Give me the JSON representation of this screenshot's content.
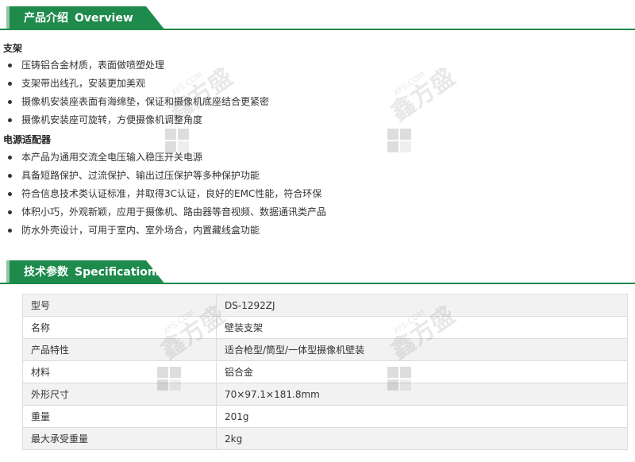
{
  "overview": {
    "title_cn": "产品介绍",
    "title_en": "Overview",
    "groups": [
      {
        "title": "支架",
        "items": [
          "压铸铝合金材质，表面做喷塑处理",
          "支架带出线孔，安装更加美观",
          "摄像机安装座表面有海绵垫，保证和摄像机底座结合更紧密",
          "摄像机安装座可旋转，方便摄像机调整角度"
        ]
      },
      {
        "title": "电源适配器",
        "items": [
          "本产品为通用交流全电压输入稳压开关电源",
          "具备短路保护、过流保护、输出过压保护等多种保护功能",
          "符合信息技术类认证标准，并取得3C认证，良好的EMC性能，符合环保",
          "体积小巧，外观新颖，应用于摄像机、路由器等音视频、数据通讯类产品",
          "防水外壳设计，可用于室内、室外场合，内置藏线盒功能"
        ]
      }
    ]
  },
  "specs": {
    "title_cn": "技术参数",
    "title_en": "Specifications",
    "rows": [
      {
        "key": "型号",
        "value": "DS-1292ZJ"
      },
      {
        "key": "名称",
        "value": "壁装支架"
      },
      {
        "key": "产品特性",
        "value": "适合枪型/筒型/一体型摄像机壁装"
      },
      {
        "key": "材料",
        "value": "铝合金"
      },
      {
        "key": "外形尺寸",
        "value": "70×97.1×181.8mm"
      },
      {
        "key": "重量",
        "value": "201g"
      },
      {
        "key": "最大承受重量",
        "value": "2kg"
      }
    ]
  },
  "watermark": {
    "text": "鑫方盛",
    "sub": "XFS.COM"
  },
  "colors": {
    "accent": "#1e8a4c",
    "row_alt": "#f2f2f2",
    "border": "#dcdcdc"
  }
}
